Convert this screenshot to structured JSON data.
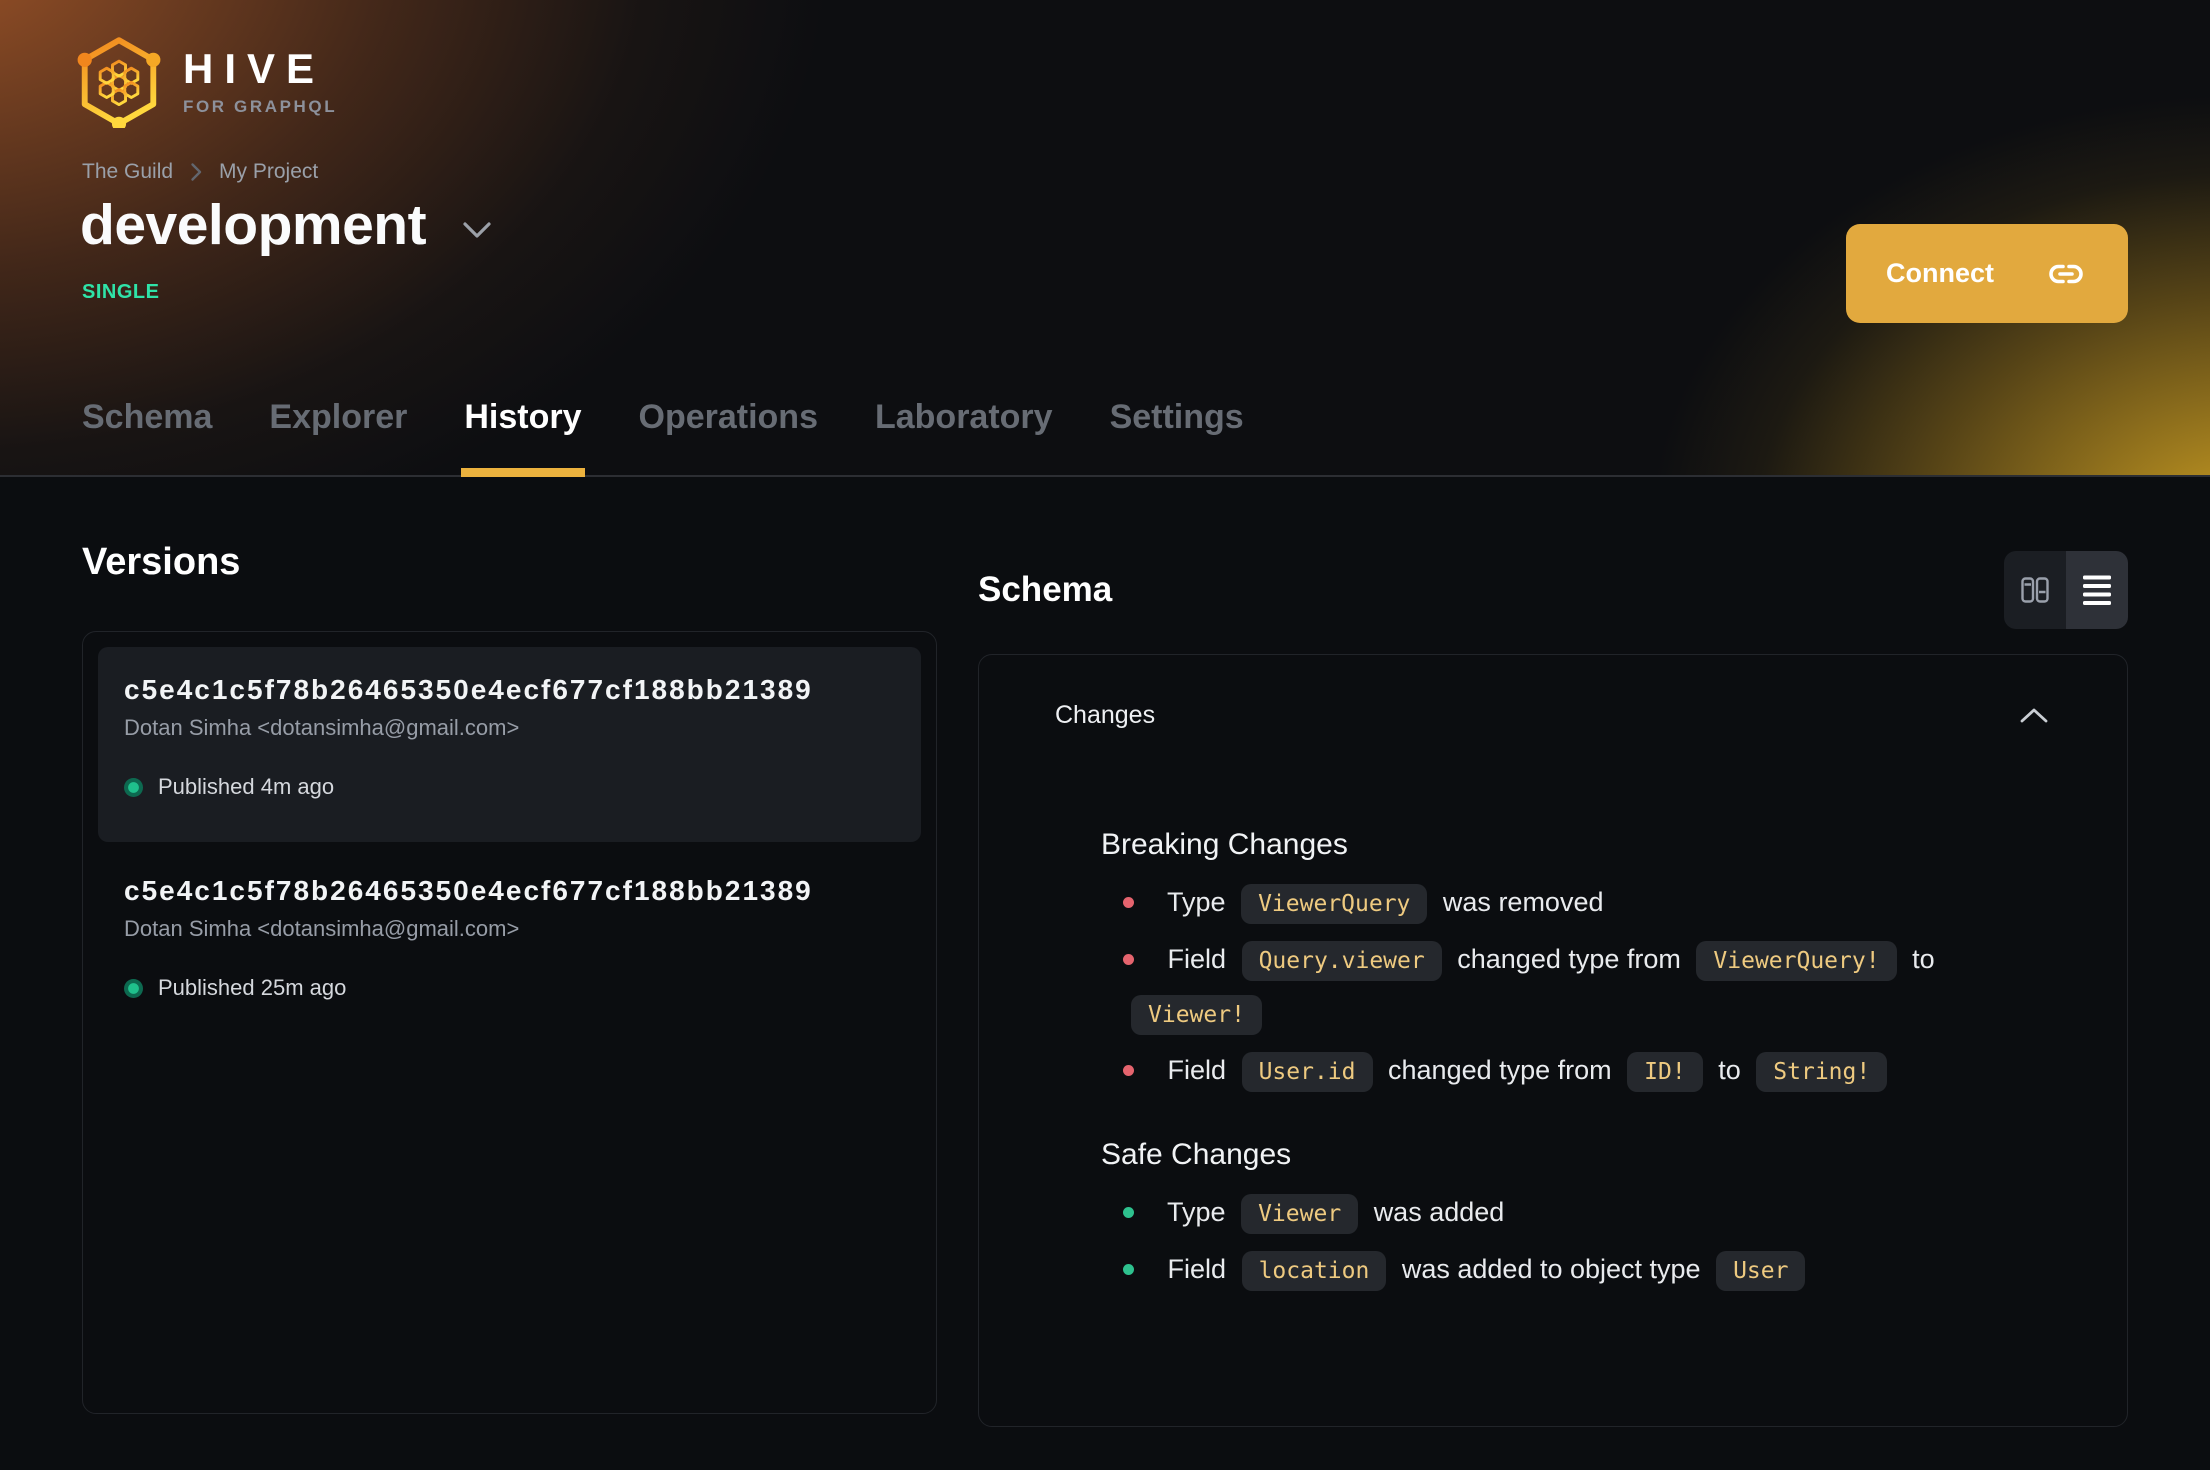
{
  "brand": {
    "name": "HIVE",
    "tagline": "FOR GRAPHQL"
  },
  "breadcrumb": {
    "org": "The Guild",
    "project": "My Project"
  },
  "target": {
    "name": "development",
    "badge": "SINGLE"
  },
  "connect_label": "Connect",
  "tabs": [
    {
      "label": "Schema"
    },
    {
      "label": "Explorer"
    },
    {
      "label": "History"
    },
    {
      "label": "Operations"
    },
    {
      "label": "Laboratory"
    },
    {
      "label": "Settings"
    }
  ],
  "versions": {
    "title": "Versions",
    "items": [
      {
        "hash": "c5e4c1c5f78b26465350e4ecf677cf188bb21389",
        "author": "Dotan Simha <dotansimha@gmail.com>",
        "status": "Published 4m ago"
      },
      {
        "hash": "c5e4c1c5f78b26465350e4ecf677cf188bb21389",
        "author": "Dotan Simha <dotansimha@gmail.com>",
        "status": "Published 25m ago"
      }
    ]
  },
  "schema": {
    "title": "Schema",
    "changes_label": "Changes",
    "breaking": {
      "title": "Breaking Changes",
      "items": [
        {
          "segments": [
            {
              "text": "Type"
            },
            {
              "code": "ViewerQuery"
            },
            {
              "text": "was removed"
            }
          ]
        },
        {
          "segments": [
            {
              "text": "Field"
            },
            {
              "code": "Query.viewer"
            },
            {
              "text": "changed type from"
            },
            {
              "code": "ViewerQuery!"
            },
            {
              "text": "to"
            },
            {
              "code": "Viewer!"
            }
          ]
        },
        {
          "segments": [
            {
              "text": "Field"
            },
            {
              "code": "User.id"
            },
            {
              "text": "changed type from"
            },
            {
              "code": "ID!"
            },
            {
              "text": "to"
            },
            {
              "code": "String!"
            }
          ]
        }
      ]
    },
    "safe": {
      "title": "Safe Changes",
      "items": [
        {
          "segments": [
            {
              "text": "Type"
            },
            {
              "code": "Viewer"
            },
            {
              "text": "was added"
            }
          ]
        },
        {
          "segments": [
            {
              "text": "Field"
            },
            {
              "code": "location"
            },
            {
              "text": "was added to object type"
            },
            {
              "code": "User"
            }
          ]
        }
      ]
    }
  },
  "colors": {
    "accent": "#e2a93e",
    "tab_underline": "#ecb23e",
    "emerald_badge": "#2fe3a8",
    "code_text": "#eeca80",
    "danger_bullet": "#e5646e",
    "safe_bullet": "#2ec18e",
    "published_dot": "#1fc08c",
    "panel_border": "#212429",
    "background": "#0b0d10"
  }
}
